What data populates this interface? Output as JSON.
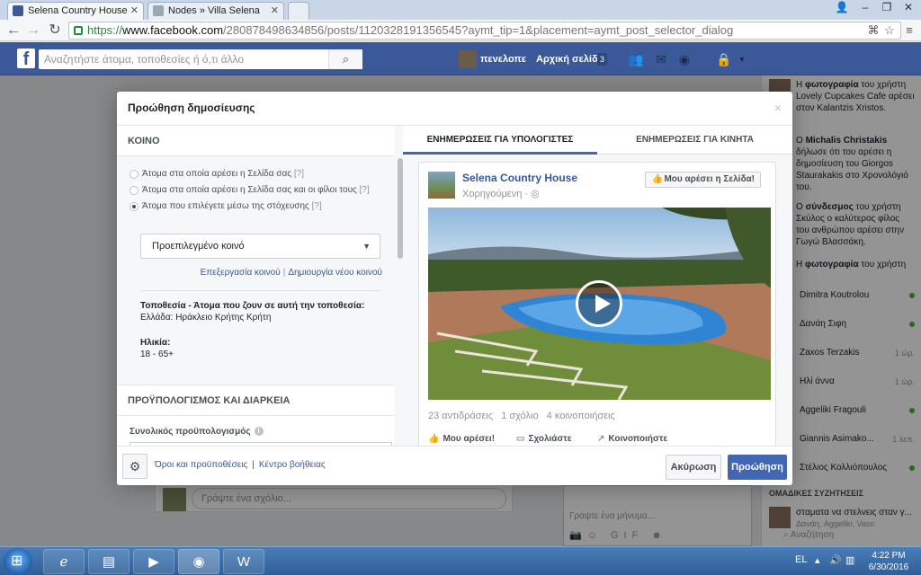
{
  "browser": {
    "tabs": [
      {
        "label": "Selena Country House",
        "active": true
      },
      {
        "label": "Nodes » Villa Selena",
        "active": false
      }
    ],
    "url_scheme": "https://",
    "url_host": "www.facebook.com",
    "url_path": "/280878498634856/posts/1120328191356545?aymt_tip=1&placement=aymt_post_selector_dialog"
  },
  "fb": {
    "logo": "f",
    "search_placeholder": "Αναζητήστε άτομα, τοποθεσίες ή ό,τι άλλο",
    "user_name": "πενελοπε",
    "home_label": "Αρχική σελίδα",
    "home_count": "3"
  },
  "background": {
    "comment_placeholder": "Γράψτε ένα σχόλιο...",
    "chat_placeholder": "Γράψτε ένα μήνυμα..."
  },
  "sidebar": {
    "ticker": [
      {
        "text_pre": "Η ",
        "bold": "φωτογραφία",
        "text_post": " του χρήστη Lovely Cupcakes Cafe αρέσει στον Kalantzis Xristos."
      },
      {
        "text_pre": "Ο ",
        "bold": "Michalis Christakis",
        "text_post": " δήλωσε ότι του αρέσει η δημοσίευση του Giorgos Staurakakis στο Χρονολόγιό του."
      },
      {
        "text_pre": "Ο ",
        "bold": "σύνδεσμος",
        "text_post": " του χρήστη Σκύλος ο καλύτερος φίλος του ανθρώπου αρέσει στην Γωγώ Βλασσάκη."
      },
      {
        "text_pre": "Η ",
        "bold": "φωτογραφία",
        "text_post": " του χρήστη Rowan Cheshire αρέσει"
      }
    ],
    "contacts": [
      {
        "name": "Dimitra Koutrolou",
        "status": "online",
        "time": ""
      },
      {
        "name": "Δανάη Σιφη",
        "status": "online",
        "time": ""
      },
      {
        "name": "Zaxos Terzakis",
        "status": "away",
        "time": "1 ώρ."
      },
      {
        "name": "Ηλί άννα",
        "status": "away",
        "time": "1 ώρ."
      },
      {
        "name": "Aggeliki Fragouli",
        "status": "online",
        "time": ""
      },
      {
        "name": "Giannis Asimako...",
        "status": "away",
        "time": "1 λεπ."
      },
      {
        "name": "Στέλιος Κολλιόπουλος",
        "status": "online",
        "time": ""
      }
    ],
    "groups_header": "ΟΜΑΔΙΚΕΣ ΣΥΖΗΤΗΣΕΙΣ",
    "group_msg": "σταματα να στελνεις σταν γ...",
    "group_members": "Δανάη, Aggeliki, Vaso",
    "search_label": "Αναζήτηση"
  },
  "dialog": {
    "title": "Προώθηση δημοσίευσης",
    "close": "×",
    "audience": {
      "header": "ΚΟΙΝΟ",
      "options": [
        {
          "label": "Άτομα στα οποία αρέσει η Σελίδα σας",
          "help": "[?]",
          "selected": false
        },
        {
          "label": "Άτομα στα οποία αρέσει η Σελίδα σας και οι φίλοι τους",
          "help": "[?]",
          "selected": false
        },
        {
          "label": "Άτομα που επιλέγετε μέσω της στόχευσης",
          "help": "[?]",
          "selected": true
        }
      ],
      "select_value": "Προεπιλεγμένο κοινό",
      "edit_link": "Επεξεργασία κοινού",
      "separator": "|",
      "new_link": "Δημιουργία νέου κοινού",
      "location_label": "Τοποθεσία - Άτομα που ζουν σε αυτή την τοποθεσία:",
      "location_value": "Ελλάδα: Ηράκλειο Κρήτης Κρήτη",
      "age_label": "Ηλικία:",
      "age_value": "18 - 65+"
    },
    "budget": {
      "header": "ΠΡΟΫΠΟΛΟΓΙΣΜΟΣ ΚΑΙ ΔΙΑΡΚΕΙΑ",
      "total_label": "Συνολικός προϋπολογισμός"
    },
    "preview": {
      "tab_desktop": "ΕΝΗΜΕΡΩΣΕΙΣ ΓΙΑ ΥΠΟΛΟΓΙΣΤΕΣ",
      "tab_mobile": "ΕΝΗΜΕΡΩΣΕΙΣ ΓΙΑ ΚΙΝΗΤΑ",
      "page_name": "Selena Country House",
      "sponsored": "Χορηγούμενη · ",
      "like_page": "Μου αρέσει η Σελίδα!",
      "reactions": "23 αντιδράσεις",
      "comments": "1 σχόλιο",
      "shares": "4 κοινοποιήσεις",
      "action_like": "Μου αρέσει!",
      "action_comment": "Σχολιάστε",
      "action_share": "Κοινοποιήστε"
    },
    "footer": {
      "terms": "Όροι και προϋποθέσεις",
      "separator": "|",
      "help": "Κέντρο βοήθειας",
      "cancel": "Ακύρωση",
      "boost": "Προώθηση"
    }
  },
  "taskbar": {
    "lang": "EL",
    "time": "4:22 PM",
    "date": "6/30/2016"
  }
}
